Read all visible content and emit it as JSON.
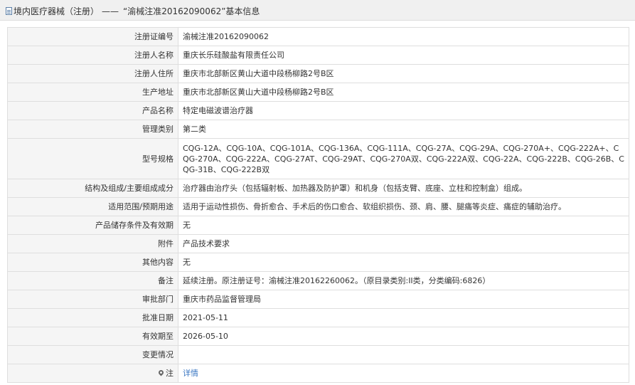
{
  "header": {
    "category": "境内医疗器械（注册）",
    "separator": "——",
    "title": "“渝械注准20162090062”基本信息"
  },
  "rows": [
    {
      "label": "注册证编号",
      "value": "渝械注准20162090062"
    },
    {
      "label": "注册人名称",
      "value": "重庆长乐硅酸盐有限责任公司"
    },
    {
      "label": "注册人住所",
      "value": "重庆市北部新区黄山大道中段杨柳路2号B区"
    },
    {
      "label": "生产地址",
      "value": "重庆市北部新区黄山大道中段杨柳路2号B区"
    },
    {
      "label": "产品名称",
      "value": "特定电磁波谱治疗器"
    },
    {
      "label": "管理类别",
      "value": "第二类"
    },
    {
      "label": "型号规格",
      "value": "CQG-12A、CQG-10A、CQG-101A、CQG-136A、CQG-111A、CQG-27A、CQG-29A、CQG-270A+、CQG-222A+、CQG-270A、CQG-222A、CQG-27AT、CQG-29AT、CQG-270A双、CQG-222A双、CQG-22A、CQG-222B、CQG-26B、CQG-31B、CQG-222B双"
    },
    {
      "label": "结构及组成/主要组成成分",
      "value": "治疗器由治疗头（包括辐射板、加热器及防护罩）和机身（包括支臂、底座、立柱和控制盒）组成。"
    },
    {
      "label": "适用范围/预期用途",
      "value": "适用于运动性损伤、骨折愈合、手术后的伤口愈合、软组织损伤、颈、肩、腰、腿痛等炎症、痛症的辅助治疗。"
    },
    {
      "label": "产品储存条件及有效期",
      "value": "无"
    },
    {
      "label": "附件",
      "value": "产品技术要求"
    },
    {
      "label": "其他内容",
      "value": "无"
    },
    {
      "label": "备注",
      "value": "延续注册。原注册证号：渝械注准20162260062。（原目录类别:II类，分类编码:6826）"
    },
    {
      "label": "审批部门",
      "value": "重庆市药品监督管理局"
    },
    {
      "label": "批准日期",
      "value": "2021-05-11"
    },
    {
      "label": "有效期至",
      "value": "2026-05-10"
    },
    {
      "label": "变更情况",
      "value": ""
    }
  ],
  "note": {
    "label": "注",
    "link": "详情"
  }
}
